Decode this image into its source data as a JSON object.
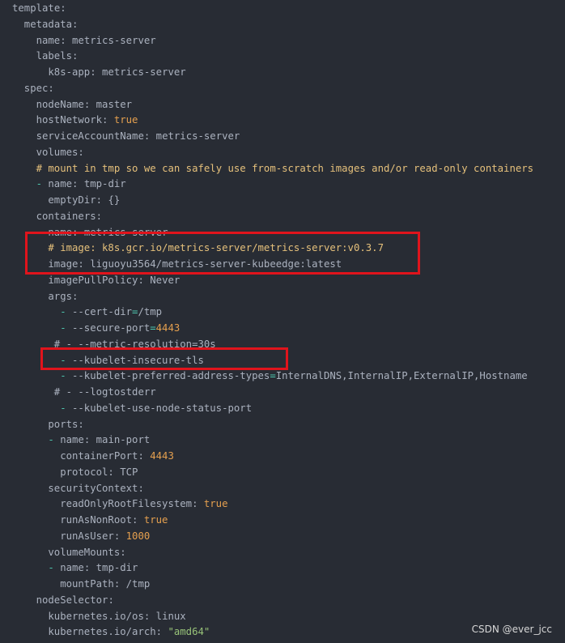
{
  "colors": {
    "background": "#282c34",
    "text": "#abb2bf",
    "dash": "#4ec9b0",
    "boolean_number": "#e5a04f",
    "string": "#98c379",
    "comment": "#e5c07b",
    "highlight_box": "#e0141c"
  },
  "watermark": "CSDN @ever_jcc",
  "lines": [
    {
      "indent": 0,
      "tokens": [
        {
          "t": "template",
          "c": "k"
        },
        {
          "t": ":",
          "c": "p"
        }
      ]
    },
    {
      "indent": 2,
      "tokens": [
        {
          "t": "metadata",
          "c": "k"
        },
        {
          "t": ":",
          "c": "p"
        }
      ]
    },
    {
      "indent": 4,
      "tokens": [
        {
          "t": "name",
          "c": "k"
        },
        {
          "t": ": ",
          "c": "p"
        },
        {
          "t": "metrics-server",
          "c": "v"
        }
      ]
    },
    {
      "indent": 4,
      "tokens": [
        {
          "t": "labels",
          "c": "k"
        },
        {
          "t": ":",
          "c": "p"
        }
      ]
    },
    {
      "indent": 6,
      "tokens": [
        {
          "t": "k8s-app",
          "c": "k"
        },
        {
          "t": ": ",
          "c": "p"
        },
        {
          "t": "metrics-server",
          "c": "v"
        }
      ]
    },
    {
      "indent": 2,
      "tokens": [
        {
          "t": "spec",
          "c": "k"
        },
        {
          "t": ":",
          "c": "p"
        }
      ]
    },
    {
      "indent": 4,
      "tokens": [
        {
          "t": "nodeName",
          "c": "k"
        },
        {
          "t": ": ",
          "c": "p"
        },
        {
          "t": "master",
          "c": "v"
        }
      ]
    },
    {
      "indent": 4,
      "tokens": [
        {
          "t": "hostNetwork",
          "c": "k"
        },
        {
          "t": ": ",
          "c": "p"
        },
        {
          "t": "true",
          "c": "b"
        }
      ]
    },
    {
      "indent": 4,
      "tokens": [
        {
          "t": "serviceAccountName",
          "c": "k"
        },
        {
          "t": ": ",
          "c": "p"
        },
        {
          "t": "metrics-server",
          "c": "v"
        }
      ]
    },
    {
      "indent": 4,
      "tokens": [
        {
          "t": "volumes",
          "c": "k"
        },
        {
          "t": ":",
          "c": "p"
        }
      ]
    },
    {
      "indent": 4,
      "tokens": [
        {
          "t": "# mount in tmp so we can safely use from-scratch images and/or read-only containers",
          "c": "c"
        }
      ]
    },
    {
      "indent": 4,
      "tokens": [
        {
          "t": "- ",
          "c": "d"
        },
        {
          "t": "name",
          "c": "k"
        },
        {
          "t": ": ",
          "c": "p"
        },
        {
          "t": "tmp-dir",
          "c": "v"
        }
      ]
    },
    {
      "indent": 6,
      "tokens": [
        {
          "t": "emptyDir",
          "c": "k"
        },
        {
          "t": ": ",
          "c": "p"
        },
        {
          "t": "{}",
          "c": "v"
        }
      ]
    },
    {
      "indent": 4,
      "tokens": [
        {
          "t": "containers",
          "c": "k"
        },
        {
          "t": ":",
          "c": "p"
        }
      ]
    },
    {
      "indent": 4,
      "tokens": [
        {
          "t": "- ",
          "c": "d"
        },
        {
          "t": "name",
          "c": "k"
        },
        {
          "t": ": ",
          "c": "p"
        },
        {
          "t": "metrics-server",
          "c": "v"
        }
      ]
    },
    {
      "indent": 6,
      "tokens": [
        {
          "t": "# image: k8s.gcr.io/metrics-server/metrics-server:v0.3.7",
          "c": "c"
        }
      ]
    },
    {
      "indent": 6,
      "tokens": [
        {
          "t": "image",
          "c": "k"
        },
        {
          "t": ": ",
          "c": "p"
        },
        {
          "t": "liguoyu3564/metrics-server-kubeedge:latest",
          "c": "v"
        }
      ]
    },
    {
      "indent": 6,
      "tokens": [
        {
          "t": "imagePullPolicy",
          "c": "k"
        },
        {
          "t": ": ",
          "c": "p"
        },
        {
          "t": "Never",
          "c": "v"
        }
      ]
    },
    {
      "indent": 6,
      "tokens": [
        {
          "t": "args",
          "c": "k"
        },
        {
          "t": ":",
          "c": "p"
        }
      ]
    },
    {
      "indent": 8,
      "tokens": [
        {
          "t": "- ",
          "c": "d"
        },
        {
          "t": "--cert-dir",
          "c": "v"
        },
        {
          "t": "=",
          "c": "d"
        },
        {
          "t": "/tmp",
          "c": "v"
        }
      ]
    },
    {
      "indent": 8,
      "tokens": [
        {
          "t": "- ",
          "c": "d"
        },
        {
          "t": "--secure-port",
          "c": "v"
        },
        {
          "t": "=",
          "c": "d"
        },
        {
          "t": "4443",
          "c": "n"
        }
      ]
    },
    {
      "indent": 7,
      "tokens": [
        {
          "t": "# - --metric-resolution=30s",
          "c": "v"
        }
      ]
    },
    {
      "indent": 8,
      "tokens": [
        {
          "t": "- ",
          "c": "d"
        },
        {
          "t": "--kubelet-insecure-tls",
          "c": "v"
        }
      ]
    },
    {
      "indent": 8,
      "tokens": [
        {
          "t": "- ",
          "c": "d"
        },
        {
          "t": "--kubelet-preferred-address-types",
          "c": "v"
        },
        {
          "t": "=",
          "c": "d"
        },
        {
          "t": "InternalDNS,InternalIP,ExternalIP,Hostname",
          "c": "v"
        }
      ]
    },
    {
      "indent": 7,
      "tokens": [
        {
          "t": "# - --logtostderr",
          "c": "v"
        }
      ]
    },
    {
      "indent": 8,
      "tokens": [
        {
          "t": "- ",
          "c": "d"
        },
        {
          "t": "--kubelet-use-node-status-port",
          "c": "v"
        }
      ]
    },
    {
      "indent": 6,
      "tokens": [
        {
          "t": "ports",
          "c": "k"
        },
        {
          "t": ":",
          "c": "p"
        }
      ]
    },
    {
      "indent": 6,
      "tokens": [
        {
          "t": "- ",
          "c": "d"
        },
        {
          "t": "name",
          "c": "k"
        },
        {
          "t": ": ",
          "c": "p"
        },
        {
          "t": "main-port",
          "c": "v"
        }
      ]
    },
    {
      "indent": 8,
      "tokens": [
        {
          "t": "containerPort",
          "c": "k"
        },
        {
          "t": ": ",
          "c": "p"
        },
        {
          "t": "4443",
          "c": "n"
        }
      ]
    },
    {
      "indent": 8,
      "tokens": [
        {
          "t": "protocol",
          "c": "k"
        },
        {
          "t": ": ",
          "c": "p"
        },
        {
          "t": "TCP",
          "c": "v"
        }
      ]
    },
    {
      "indent": 6,
      "tokens": [
        {
          "t": "securityContext",
          "c": "k"
        },
        {
          "t": ":",
          "c": "p"
        }
      ]
    },
    {
      "indent": 8,
      "tokens": [
        {
          "t": "readOnlyRootFilesystem",
          "c": "k"
        },
        {
          "t": ": ",
          "c": "p"
        },
        {
          "t": "true",
          "c": "b"
        }
      ]
    },
    {
      "indent": 8,
      "tokens": [
        {
          "t": "runAsNonRoot",
          "c": "k"
        },
        {
          "t": ": ",
          "c": "p"
        },
        {
          "t": "true",
          "c": "b"
        }
      ]
    },
    {
      "indent": 8,
      "tokens": [
        {
          "t": "runAsUser",
          "c": "k"
        },
        {
          "t": ": ",
          "c": "p"
        },
        {
          "t": "1000",
          "c": "n"
        }
      ]
    },
    {
      "indent": 6,
      "tokens": [
        {
          "t": "volumeMounts",
          "c": "k"
        },
        {
          "t": ":",
          "c": "p"
        }
      ]
    },
    {
      "indent": 6,
      "tokens": [
        {
          "t": "- ",
          "c": "d"
        },
        {
          "t": "name",
          "c": "k"
        },
        {
          "t": ": ",
          "c": "p"
        },
        {
          "t": "tmp-dir",
          "c": "v"
        }
      ]
    },
    {
      "indent": 8,
      "tokens": [
        {
          "t": "mountPath",
          "c": "k"
        },
        {
          "t": ": ",
          "c": "p"
        },
        {
          "t": "/tmp",
          "c": "v"
        }
      ]
    },
    {
      "indent": 4,
      "tokens": [
        {
          "t": "nodeSelector",
          "c": "k"
        },
        {
          "t": ":",
          "c": "p"
        }
      ]
    },
    {
      "indent": 6,
      "tokens": [
        {
          "t": "kubernetes.io/os",
          "c": "k"
        },
        {
          "t": ": ",
          "c": "p"
        },
        {
          "t": "linux",
          "c": "v"
        }
      ]
    },
    {
      "indent": 6,
      "tokens": [
        {
          "t": "kubernetes.io/arch",
          "c": "k"
        },
        {
          "t": ": ",
          "c": "p"
        },
        {
          "t": "\"amd64\"",
          "c": "s"
        }
      ]
    }
  ]
}
